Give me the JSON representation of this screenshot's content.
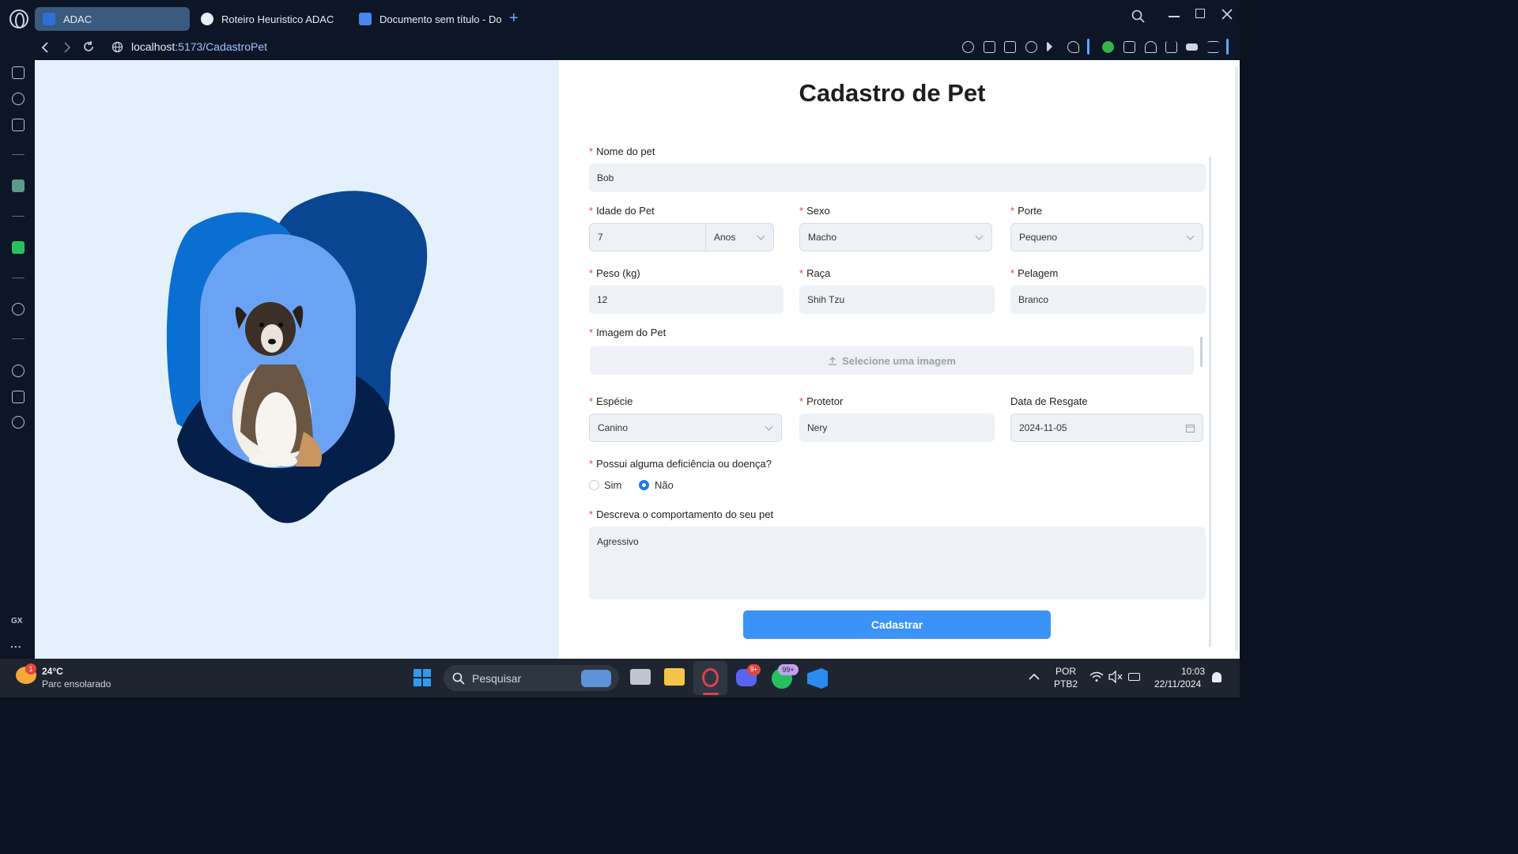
{
  "browser": {
    "tabs": [
      {
        "label": "ADAC",
        "active": true
      },
      {
        "label": "Roteiro Heuristico ADAC",
        "active": false
      },
      {
        "label": "Documento sem título - Do",
        "active": false
      }
    ],
    "new_tab_label": "+",
    "url_host": "localhost",
    "url_path": ":5173/CadastroPet"
  },
  "sidebar": {
    "badge": "GX",
    "more": "..."
  },
  "form": {
    "title": "Cadastro de Pet",
    "required_mark": "*",
    "nome_label": "Nome do pet",
    "nome_value": "Bob",
    "idade_label": "Idade do Pet",
    "idade_value": "7",
    "idade_unit": "Anos",
    "sexo_label": "Sexo",
    "sexo_value": "Macho",
    "porte_label": "Porte",
    "porte_value": "Pequeno",
    "peso_label": "Peso (kg)",
    "peso_value": "12",
    "raca_label": "Raça",
    "raca_value": "Shih Tzu",
    "pelagem_label": "Pelagem",
    "pelagem_value": "Branco",
    "imagem_label": "Imagem do Pet",
    "imagem_button": "Selecione uma imagem",
    "especie_label": "Espécie",
    "especie_value": "Canino",
    "protetor_label": "Protetor",
    "protetor_value": "Nery",
    "resgate_label": "Data de Resgate",
    "resgate_value": "2024-11-05",
    "deficiencia_label": "Possui alguma deficiência ou doença?",
    "deficiencia_options": [
      "Sim",
      "Não"
    ],
    "deficiencia_selected": "Não",
    "comportamento_label": "Descreva o comportamento do seu pet",
    "comportamento_value": "Agressivo",
    "submit_label": "Cadastrar"
  },
  "taskbar": {
    "weather_temp": "24°C",
    "weather_desc": "Parc ensolarado",
    "weather_badge": "1",
    "search_placeholder": "Pesquisar",
    "discord_badge": "9+",
    "whatsapp_badge": "99+",
    "lang_line1": "POR",
    "lang_line2": "PTB2",
    "time": "10:03",
    "date": "22/11/2024"
  },
  "colors": {
    "primary": "#3b93f7",
    "blob_light": "#0a6fd1",
    "blob_mid": "#0a4591",
    "blob_dark": "#041f4a",
    "frame": "#6aa3f3"
  }
}
